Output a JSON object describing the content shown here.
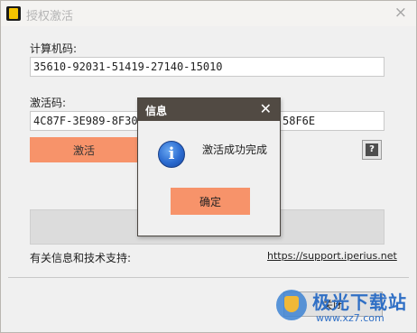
{
  "window": {
    "title": "授权激活",
    "close_glyph": "×"
  },
  "form": {
    "computer_code_label": "计算机码:",
    "computer_code_value": "35610-92031-51419-27140-15010",
    "activation_code_label": "激活码:",
    "activation_code_value_left": "4C87F-3E989-8F302-",
    "activation_code_value_right": "58F6E",
    "activate_button": "激活",
    "help_glyph": "?"
  },
  "support": {
    "label": "有关信息和技术支持:",
    "link": "https://support.iperius.net"
  },
  "footer": {
    "close_button": "关闭"
  },
  "dialog": {
    "title": "信息",
    "close_glyph": "✕",
    "icon": "info-icon",
    "icon_glyph": "i",
    "message": "激活成功完成",
    "ok_button": "确定"
  },
  "watermark": {
    "brand": "极光下载站",
    "url": "www.xz7.com"
  },
  "colors": {
    "accent_button": "#f7936a",
    "dialog_titlebar": "#514a43"
  }
}
